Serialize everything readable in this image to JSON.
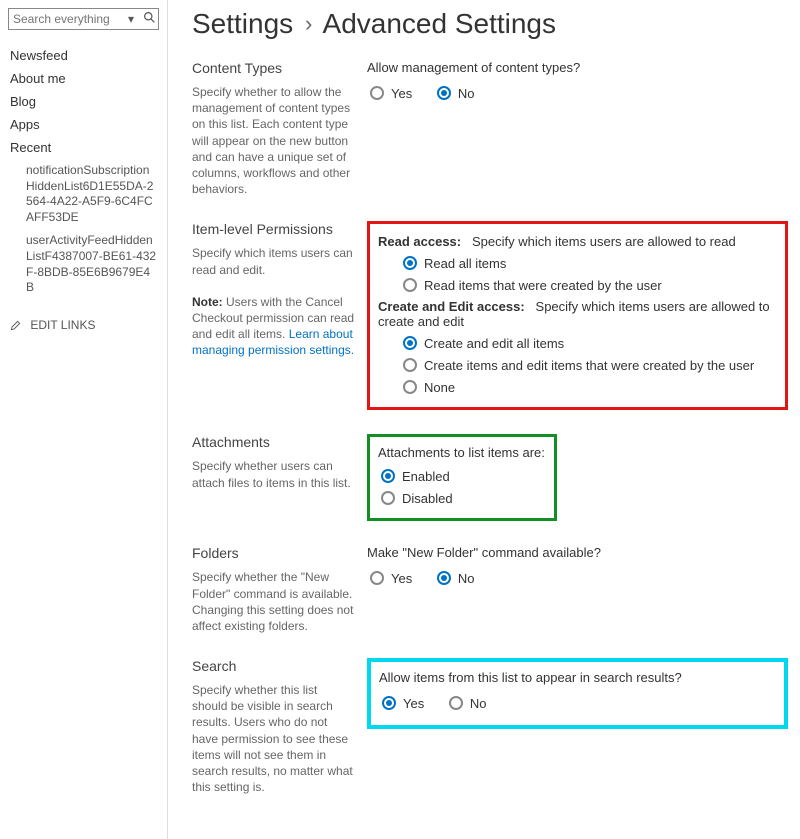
{
  "search": {
    "placeholder": "Search everything"
  },
  "nav": {
    "newsfeed": "Newsfeed",
    "about": "About me",
    "blog": "Blog",
    "apps": "Apps"
  },
  "recent": {
    "heading": "Recent",
    "items": [
      "notificationSubscriptionHiddenList6D1E55DA-2564-4A22-A5F9-6C4FCAFF53DE",
      "userActivityFeedHiddenListF4387007-BE61-432F-8BDB-85E6B9679E4B"
    ]
  },
  "editLinks": "EDIT LINKS",
  "breadcrumb": {
    "parent": "Settings",
    "current": "Advanced Settings"
  },
  "contentTypes": {
    "title": "Content Types",
    "desc": "Specify whether to allow the management of content types on this list. Each content type will appear on the new button and can have a unique set of columns, workflows and other behaviors.",
    "prompt": "Allow management of content types?",
    "yes": "Yes",
    "no": "No"
  },
  "itemPerm": {
    "title": "Item-level Permissions",
    "desc1": "Specify which items users can read and edit.",
    "noteLead": "Note:",
    "noteBody": " Users with the Cancel Checkout permission can read and edit all items. ",
    "noteLink": "Learn about managing permission settings.",
    "readAccessLabel": "Read access:",
    "readAccessDesc": "Specify which items users are allowed to read",
    "readAll": "Read all items",
    "readOwn": "Read items that were created by the user",
    "createAccessLabel": "Create and Edit access:",
    "createAccessDesc": "Specify which items users are allowed to create and edit",
    "createAll": "Create and edit all items",
    "createOwn": "Create items and edit items that were created by the user",
    "none": "None"
  },
  "attachments": {
    "title": "Attachments",
    "desc": "Specify whether users can attach files to items in this list.",
    "prompt": "Attachments to list items are:",
    "enabled": "Enabled",
    "disabled": "Disabled"
  },
  "folders": {
    "title": "Folders",
    "desc": "Specify whether the \"New Folder\" command is available. Changing this setting does not affect existing folders.",
    "prompt": "Make \"New Folder\" command available?",
    "yes": "Yes",
    "no": "No"
  },
  "searchSec": {
    "title": "Search",
    "desc": "Specify whether this list should be visible in search results. Users who do not have permission to see these items will not see them in search results, no matter what this setting is.",
    "prompt": "Allow items from this list to appear in search results?",
    "yes": "Yes",
    "no": "No"
  }
}
